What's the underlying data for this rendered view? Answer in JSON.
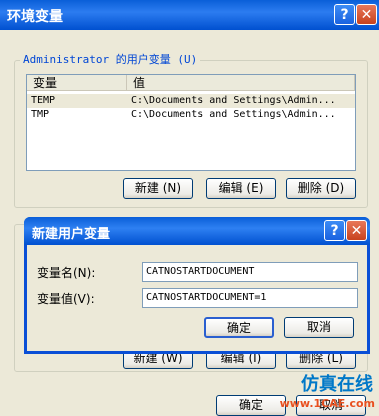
{
  "window": {
    "title": "环境变量",
    "help": "?",
    "close": "✕"
  },
  "user_vars": {
    "group_label": "Administrator 的用户变量 (U)",
    "headers": [
      "变量",
      "值"
    ],
    "rows": [
      {
        "name": "TEMP",
        "value": "C:\\Documents and Settings\\Admin..."
      },
      {
        "name": "TMP",
        "value": "C:\\Documents and Settings\\Admin..."
      }
    ],
    "new_label": "新建 (N)",
    "edit_label": "编辑 (E)",
    "delete_label": "删除 (D)"
  },
  "system_vars": {
    "new_label": "新建 (W)",
    "edit_label": "编辑 (I)",
    "delete_label": "删除 (L)"
  },
  "main_ok": "确定",
  "main_cancel": "取消",
  "dialog": {
    "title": "新建用户变量",
    "help": "?",
    "close": "✕",
    "name_label": "变量名(N):",
    "name_value": "CATNOSTARTDOCUMENT",
    "value_label": "变量值(V):",
    "value_value": "CATNOSTARTDOCUMENT=1",
    "ok": "确定",
    "cancel": "取消"
  },
  "watermark": {
    "text": "仿真在线",
    "url": "www.1CAE.com"
  }
}
